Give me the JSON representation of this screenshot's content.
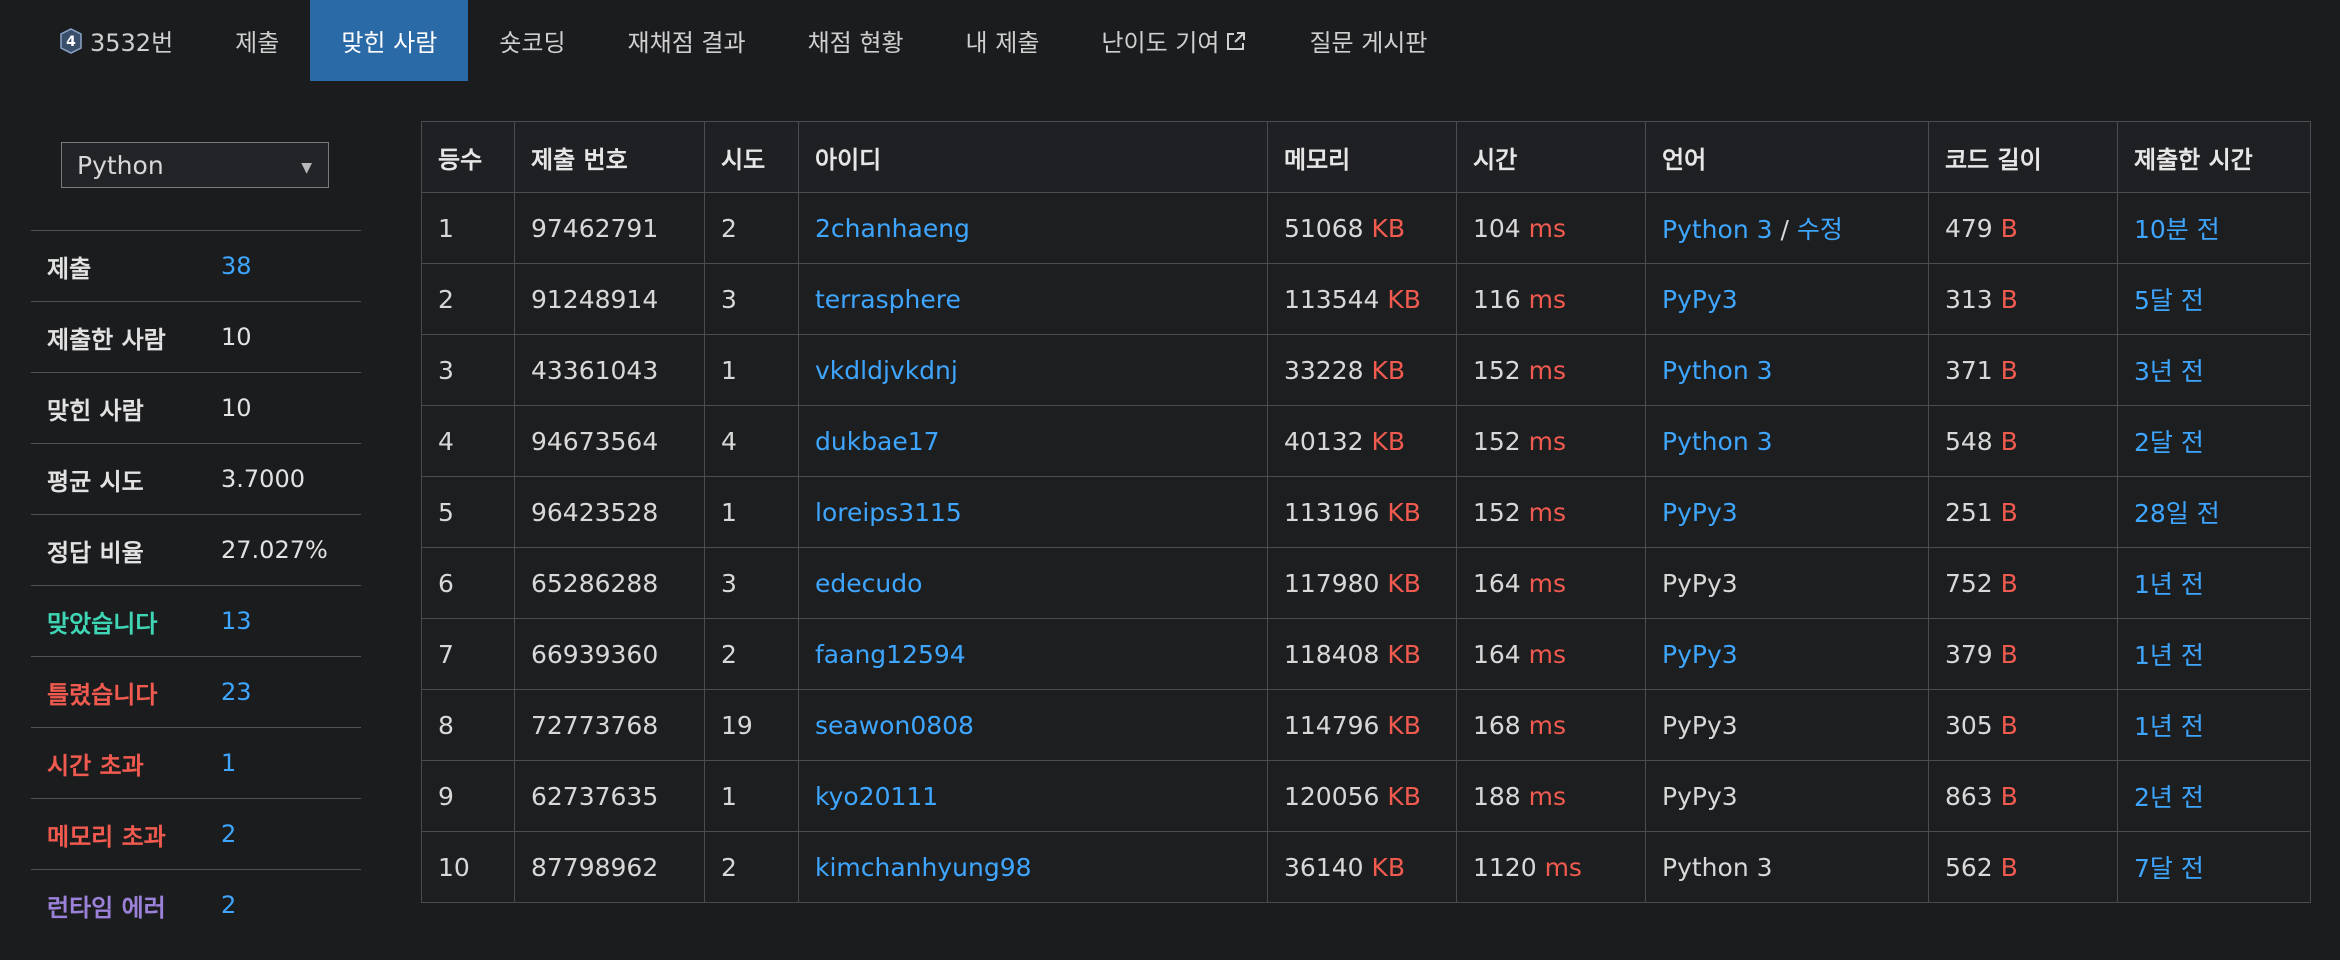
{
  "nav": {
    "problem_badge": "4",
    "items": [
      {
        "label": "3532번"
      },
      {
        "label": "제출"
      },
      {
        "label": "맞힌 사람"
      },
      {
        "label": "숏코딩"
      },
      {
        "label": "재채점 결과"
      },
      {
        "label": "채점 현황"
      },
      {
        "label": "내 제출"
      },
      {
        "label": "난이도 기여"
      },
      {
        "label": "질문 게시판"
      }
    ]
  },
  "sidebar": {
    "language_select": "Python",
    "stats": [
      {
        "label": "제출",
        "value": "38"
      },
      {
        "label": "제출한 사람",
        "value": "10"
      },
      {
        "label": "맞힌 사람",
        "value": "10"
      },
      {
        "label": "평균 시도",
        "value": "3.7000"
      },
      {
        "label": "정답 비율",
        "value": "27.027%"
      },
      {
        "label": "맞았습니다",
        "value": "13"
      },
      {
        "label": "틀렸습니다",
        "value": "23"
      },
      {
        "label": "시간 초과",
        "value": "1"
      },
      {
        "label": "메모리 초과",
        "value": "2"
      },
      {
        "label": "런타임 에러",
        "value": "2"
      }
    ]
  },
  "table": {
    "headers": [
      "등수",
      "제출 번호",
      "시도",
      "아이디",
      "메모리",
      "시간",
      "언어",
      "코드 길이",
      "제출한 시간"
    ],
    "memory_unit": "KB",
    "time_unit": "ms",
    "length_unit": "B",
    "edit_separator": "/",
    "edit_label": "수정",
    "rows": [
      {
        "rank": "1",
        "submission": "97462791",
        "tries": "2",
        "user": "2chanhaeng",
        "memory": "51068",
        "time": "104",
        "language": "Python 3",
        "length": "479",
        "submitted": "10분 전"
      },
      {
        "rank": "2",
        "submission": "91248914",
        "tries": "3",
        "user": "terrasphere",
        "memory": "113544",
        "time": "116",
        "language": "PyPy3",
        "length": "313",
        "submitted": "5달 전"
      },
      {
        "rank": "3",
        "submission": "43361043",
        "tries": "1",
        "user": "vkdldjvkdnj",
        "memory": "33228",
        "time": "152",
        "language": "Python 3",
        "length": "371",
        "submitted": "3년 전"
      },
      {
        "rank": "4",
        "submission": "94673564",
        "tries": "4",
        "user": "dukbae17",
        "memory": "40132",
        "time": "152",
        "language": "Python 3",
        "length": "548",
        "submitted": "2달 전"
      },
      {
        "rank": "5",
        "submission": "96423528",
        "tries": "1",
        "user": "loreips3115",
        "memory": "113196",
        "time": "152",
        "language": "PyPy3",
        "length": "251",
        "submitted": "28일 전"
      },
      {
        "rank": "6",
        "submission": "65286288",
        "tries": "3",
        "user": "edecudo",
        "memory": "117980",
        "time": "164",
        "language": "PyPy3",
        "length": "752",
        "submitted": "1년 전"
      },
      {
        "rank": "7",
        "submission": "66939360",
        "tries": "2",
        "user": "faang12594",
        "memory": "118408",
        "time": "164",
        "language": "PyPy3",
        "length": "379",
        "submitted": "1년 전"
      },
      {
        "rank": "8",
        "submission": "72773768",
        "tries": "19",
        "user": "seawon0808",
        "memory": "114796",
        "time": "168",
        "language": "PyPy3",
        "length": "305",
        "submitted": "1년 전"
      },
      {
        "rank": "9",
        "submission": "62737635",
        "tries": "1",
        "user": "kyo20111",
        "memory": "120056",
        "time": "188",
        "language": "PyPy3",
        "length": "863",
        "submitted": "2년 전"
      },
      {
        "rank": "10",
        "submission": "87798962",
        "tries": "2",
        "user": "kimchanhyung98",
        "memory": "36140",
        "time": "1120",
        "language": "Python 3",
        "length": "562",
        "submitted": "7달 전"
      }
    ]
  }
}
